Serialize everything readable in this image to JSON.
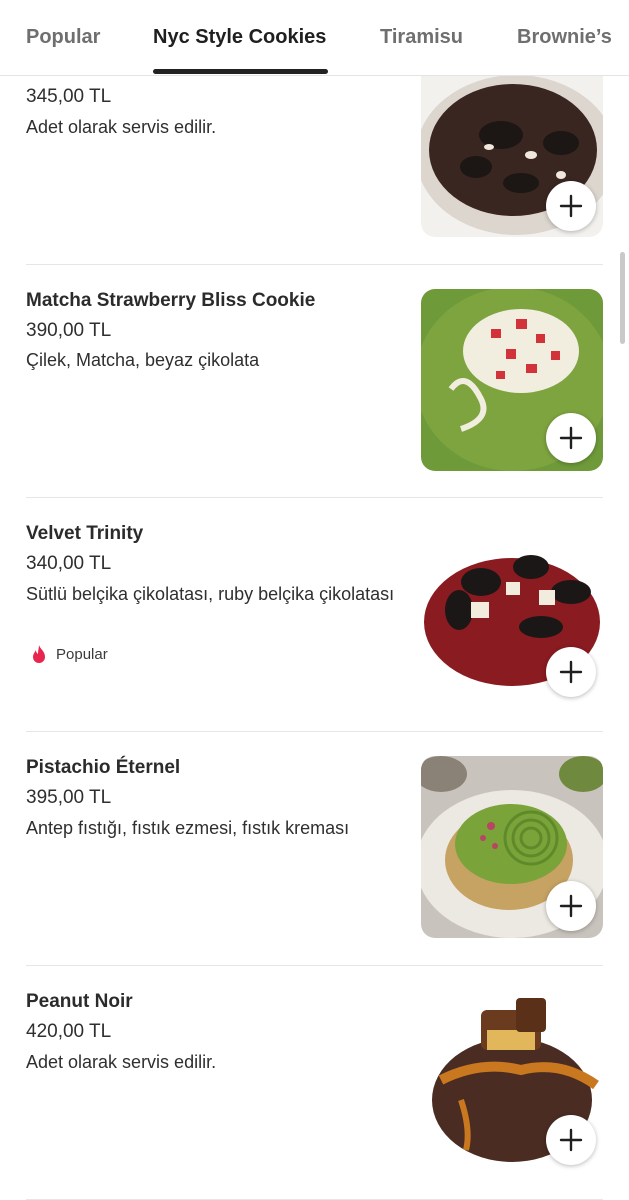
{
  "tabs": [
    {
      "label": "Popular",
      "active": false
    },
    {
      "label": "Nyc Style Cookies",
      "active": true
    },
    {
      "label": "Tiramisu",
      "active": false
    },
    {
      "label": "Brownie’s",
      "active": false
    }
  ],
  "items": [
    {
      "name": "",
      "price": "345,00 TL",
      "description": "Adet olarak servis edilir.",
      "image": "dark-chocolate-oreo-cookie-photo"
    },
    {
      "name": "Matcha Strawberry Bliss Cookie",
      "price": "390,00 TL",
      "description": "Çilek, Matcha, beyaz çikolata",
      "image": "matcha-strawberry-cookie-photo"
    },
    {
      "name": "Velvet Trinity",
      "price": "340,00 TL",
      "description": "Sütlü belçika çikolatası, ruby belçika çikolatası",
      "badge": "Popular",
      "badge_icon": "flame-icon",
      "image": "red-velvet-oreo-cookie-photo"
    },
    {
      "name": "Pistachio Éternel",
      "price": "395,00 TL",
      "description": "Antep fıstığı, fıstık ezmesi, fıstık kreması",
      "image": "pistachio-cookie-photo"
    },
    {
      "name": "Peanut Noir",
      "price": "420,00 TL",
      "description": "Adet olarak servis edilir.",
      "image": "peanut-caramel-cookie-photo"
    }
  ],
  "add_icon": "plus-icon",
  "colors": {
    "accent": "#222222",
    "badge_flame": "#e8254d",
    "divider": "#e6e6e6"
  }
}
